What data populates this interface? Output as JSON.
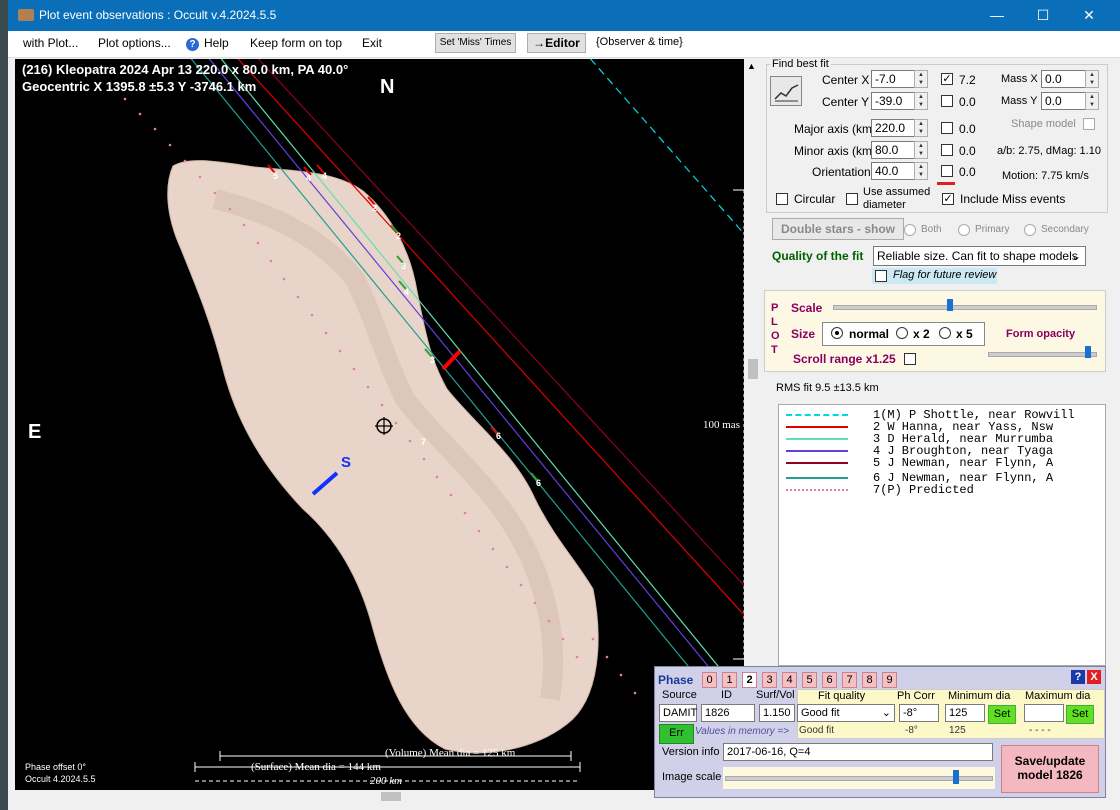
{
  "window": {
    "title": "Plot event observations : Occult v.4.2024.5.5"
  },
  "menu": {
    "with_plot": "with Plot...",
    "plot_options": "Plot options...",
    "help": "Help",
    "keep_on_top": "Keep form on top",
    "exit": "Exit",
    "set_miss_times": "Set 'Miss' Times",
    "editor": "→Editor",
    "observer_time": "{Observer & time}"
  },
  "plot": {
    "header_line1": "(216) Kleopatra  2024 Apr 13  220.0 x 80.0 km, PA 40.0°",
    "header_line2": "Geocentric  X  1395.8 ±5.3  Y -3746.1 km",
    "north": "N",
    "east": "E",
    "south": "S",
    "scale_mas": "100 mas",
    "phase_offset": "Phase offset 0°",
    "version": "Occult 4.2024.5.5",
    "volume_dia": "(Volume) Mean dia = 125 km",
    "surface_dia": "(Surface) Mean dia = 144 km",
    "km200": "200 km",
    "chord_labels_top": [
      "5",
      "4",
      "4",
      "3",
      "2",
      "2",
      "3",
      "4",
      "3"
    ],
    "chord_labels_bottom": [
      "7",
      "6",
      "6"
    ]
  },
  "fit": {
    "group_title": "Find best fit",
    "center_x_label": "Center X",
    "center_x": "-7.0",
    "center_y_label": "Center Y",
    "center_y": "-39.0",
    "cx_check_val": "7.2",
    "cy_check_val": "0.0",
    "mass_x_label": "Mass X",
    "mass_x": "0.0",
    "mass_y_label": "Mass Y",
    "mass_y": "0.0",
    "major_label": "Major axis (km)",
    "major": "220.0",
    "major_check": "0.0",
    "minor_label": "Minor axis (km)",
    "minor": "80.0",
    "minor_check": "0.0",
    "orient_label": "Orientation",
    "orient": "40.0",
    "orient_check": "0.0",
    "shape_model": "Shape model",
    "ab_dmag": "a/b: 2.75, dMag: 1.10",
    "motion": "Motion: 7.75 km/s",
    "circular": "Circular",
    "use_assumed1": "Use assumed",
    "use_assumed2": "diameter",
    "include_miss": "Include Miss events",
    "double_stars": "Double stars - show",
    "both": "Both",
    "primary": "Primary",
    "secondary": "Secondary",
    "quality_label": "Quality of the fit",
    "quality_value": "Reliable size. Can fit to shape models",
    "flag_review": "Flag for future review"
  },
  "plotctl": {
    "plot_vertical": [
      "P",
      "L",
      "O",
      "T"
    ],
    "scale": "Scale",
    "size": "Size",
    "normal": "normal",
    "x2": "x 2",
    "x5": "x 5",
    "form_opacity": "Form opacity",
    "scroll_range": "Scroll range x1.25"
  },
  "rms": "RMS fit 9.5 ±13.5 km",
  "legend": [
    {
      "text": "1(M) P Shottle, near Rowvill",
      "color": "#00d8e8",
      "style": "dashed"
    },
    {
      "text": "2    W Hanna, near Yass, Nsw",
      "color": "#e00000",
      "style": "solid"
    },
    {
      "text": "3    D Herald, near Murrumba",
      "color": "#60e0b0",
      "style": "solid"
    },
    {
      "text": "4    J Broughton, near Tyaga",
      "color": "#6040e0",
      "style": "solid"
    },
    {
      "text": "5    J Newman, near Flynn, A",
      "color": "#900020",
      "style": "solid"
    },
    {
      "text": "6    J Newman, near Flynn, A",
      "color": "#20a090",
      "style": "solid"
    },
    {
      "text": "7(P) Predicted",
      "color": "#e080a0",
      "style": "dotted"
    }
  ],
  "phase": {
    "title": "Phase",
    "numbers": [
      "0",
      "1",
      "2",
      "3",
      "4",
      "5",
      "6",
      "7",
      "8",
      "9"
    ],
    "source_label": "Source",
    "source": "DAMIT",
    "id_label": "ID",
    "id": "1826",
    "surfvol_label": "Surf/Vol",
    "surfvol": "1.150",
    "fitq_label": "Fit quality",
    "fitq": "Good fit",
    "fitq_mem": "Good fit",
    "phcorr_label": "Ph Corr",
    "phcorr": "-8°",
    "phcorr_mem": "-8°",
    "mindia_label": "Minimum dia",
    "mindia": "125",
    "mindia_mem": "125",
    "maxdia_label": "Maximum dia",
    "maxdia_mem": "- - - -",
    "set": "Set",
    "err": "Err",
    "values_mem": "Values in memory =>",
    "version_label": "Version info",
    "version": "2017-06-16, Q=4",
    "image_scale": "Image scale",
    "save_btn": "Save/update model 1826",
    "help": "?",
    "close": "X"
  }
}
